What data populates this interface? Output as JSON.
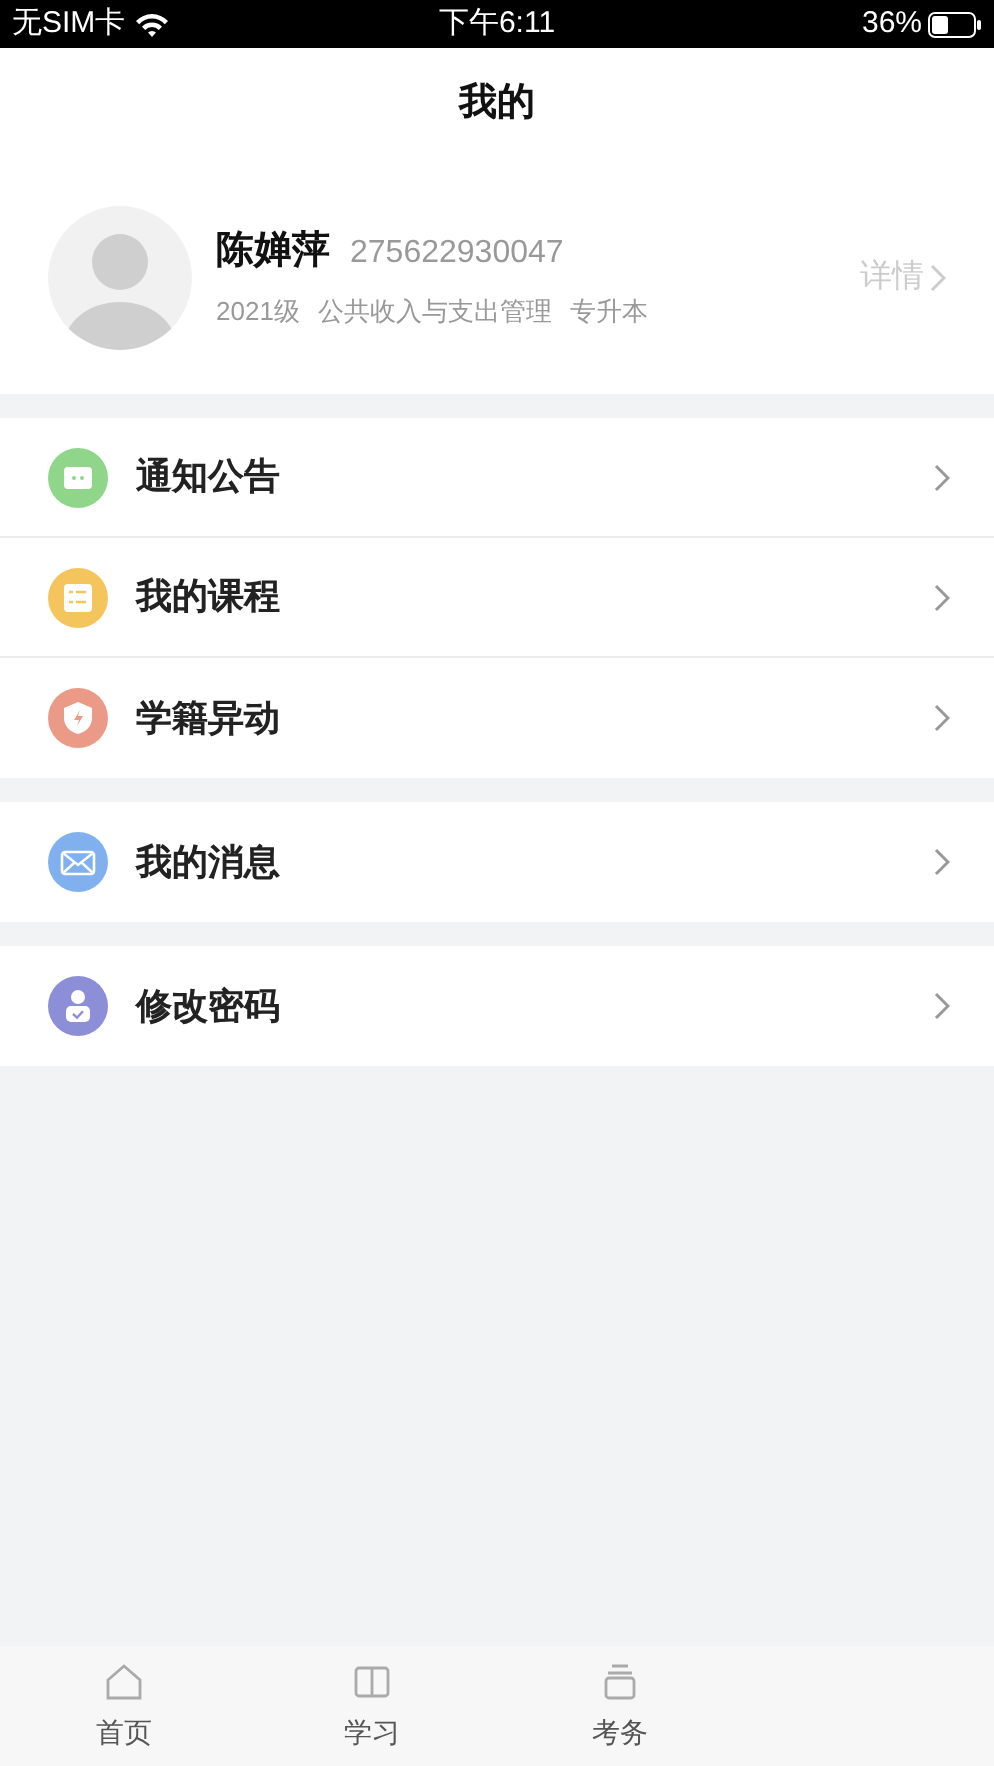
{
  "status_bar": {
    "carrier": "无SIM卡",
    "time": "下午6:11",
    "battery": "36%"
  },
  "header": {
    "title": "我的"
  },
  "profile": {
    "name": "陈婵萍",
    "student_id": "275622930047",
    "details": [
      "2021级",
      "公共收入与支出管理",
      "专升本"
    ],
    "link": "详情"
  },
  "menu_groups": [
    {
      "items": [
        {
          "label": "通知公告",
          "kind": "chat",
          "color": "#8fd68b"
        },
        {
          "label": "我的课程",
          "kind": "list",
          "color": "#f3c55c"
        },
        {
          "label": "学籍异动",
          "kind": "shield",
          "color": "#ea9a87"
        }
      ]
    },
    {
      "items": [
        {
          "label": "我的消息",
          "kind": "mail",
          "color": "#80b1ee"
        }
      ]
    },
    {
      "items": [
        {
          "label": "修改密码",
          "kind": "user",
          "color": "#8d8ed8"
        }
      ]
    }
  ],
  "tab_bar": [
    {
      "label": "首页",
      "kind": "home",
      "selected": false
    },
    {
      "label": "学习",
      "kind": "book",
      "selected": false
    },
    {
      "label": "考务",
      "kind": "stack",
      "selected": false
    }
  ]
}
